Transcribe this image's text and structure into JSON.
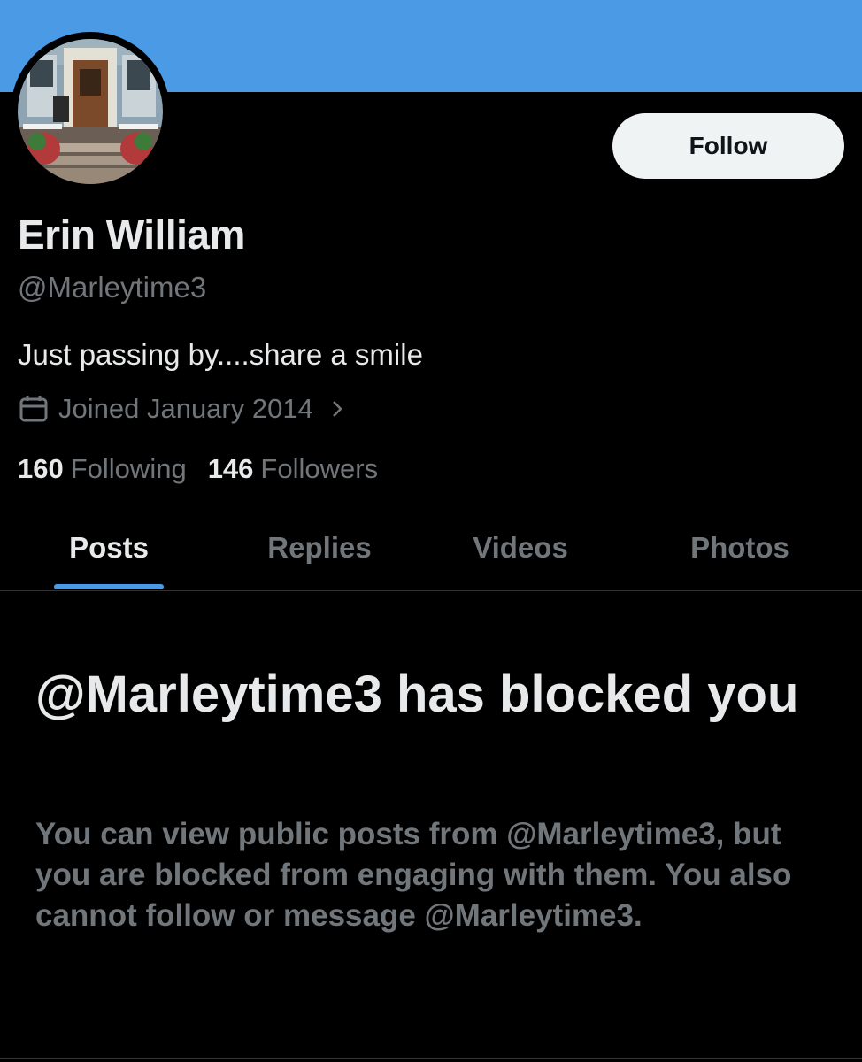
{
  "colors": {
    "banner": "#4a9ae6",
    "background": "#000000",
    "primary_text": "#e7e9ea",
    "secondary_text": "#71767b",
    "accent": "#4a9ae6",
    "follow_button_bg": "#eff3f4"
  },
  "profile": {
    "avatar_icon": "profile-photo-storefront",
    "name": "Erin William",
    "handle": "@Marleytime3",
    "bio": "Just passing by....share a smile",
    "joined_icon": "calendar-icon",
    "joined": "Joined January 2014",
    "following_count": "160",
    "following_label": "Following",
    "followers_count": "146",
    "followers_label": "Followers"
  },
  "actions": {
    "follow_label": "Follow"
  },
  "tabs": [
    {
      "label": "Posts",
      "active": true
    },
    {
      "label": "Replies",
      "active": false
    },
    {
      "label": "Videos",
      "active": false
    },
    {
      "label": "Photos",
      "active": false
    }
  ],
  "blocked": {
    "title": "@Marleytime3 has blocked you",
    "message": "You can view public posts from @Marleytime3, but you are blocked from engaging with them. You also cannot follow or message @Marleytime3."
  }
}
